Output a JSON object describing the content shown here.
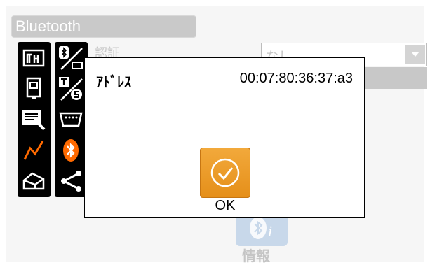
{
  "window": {
    "title": "Bluetooth"
  },
  "background": {
    "auth_label": "認証",
    "auth_select_value": "なし",
    "info_button_label": "情報"
  },
  "sidebar": {
    "column1": [
      "measure-icon",
      "instrument-icon",
      "keyboard-doc-icon",
      "graph-icon",
      "printer-icon"
    ],
    "column2": [
      "bluetooth-usb-icon",
      "toggle-setting-icon",
      "serial-port-icon",
      "bluetooth-icon",
      "share-icon"
    ],
    "active_color": "#ff6a00"
  },
  "dialog": {
    "address_label": "ｱﾄﾞﾚｽ",
    "address_value": "00:07:80:36:37:a3",
    "ok_label": "OK"
  },
  "colors": {
    "accent": "#f0a030"
  }
}
